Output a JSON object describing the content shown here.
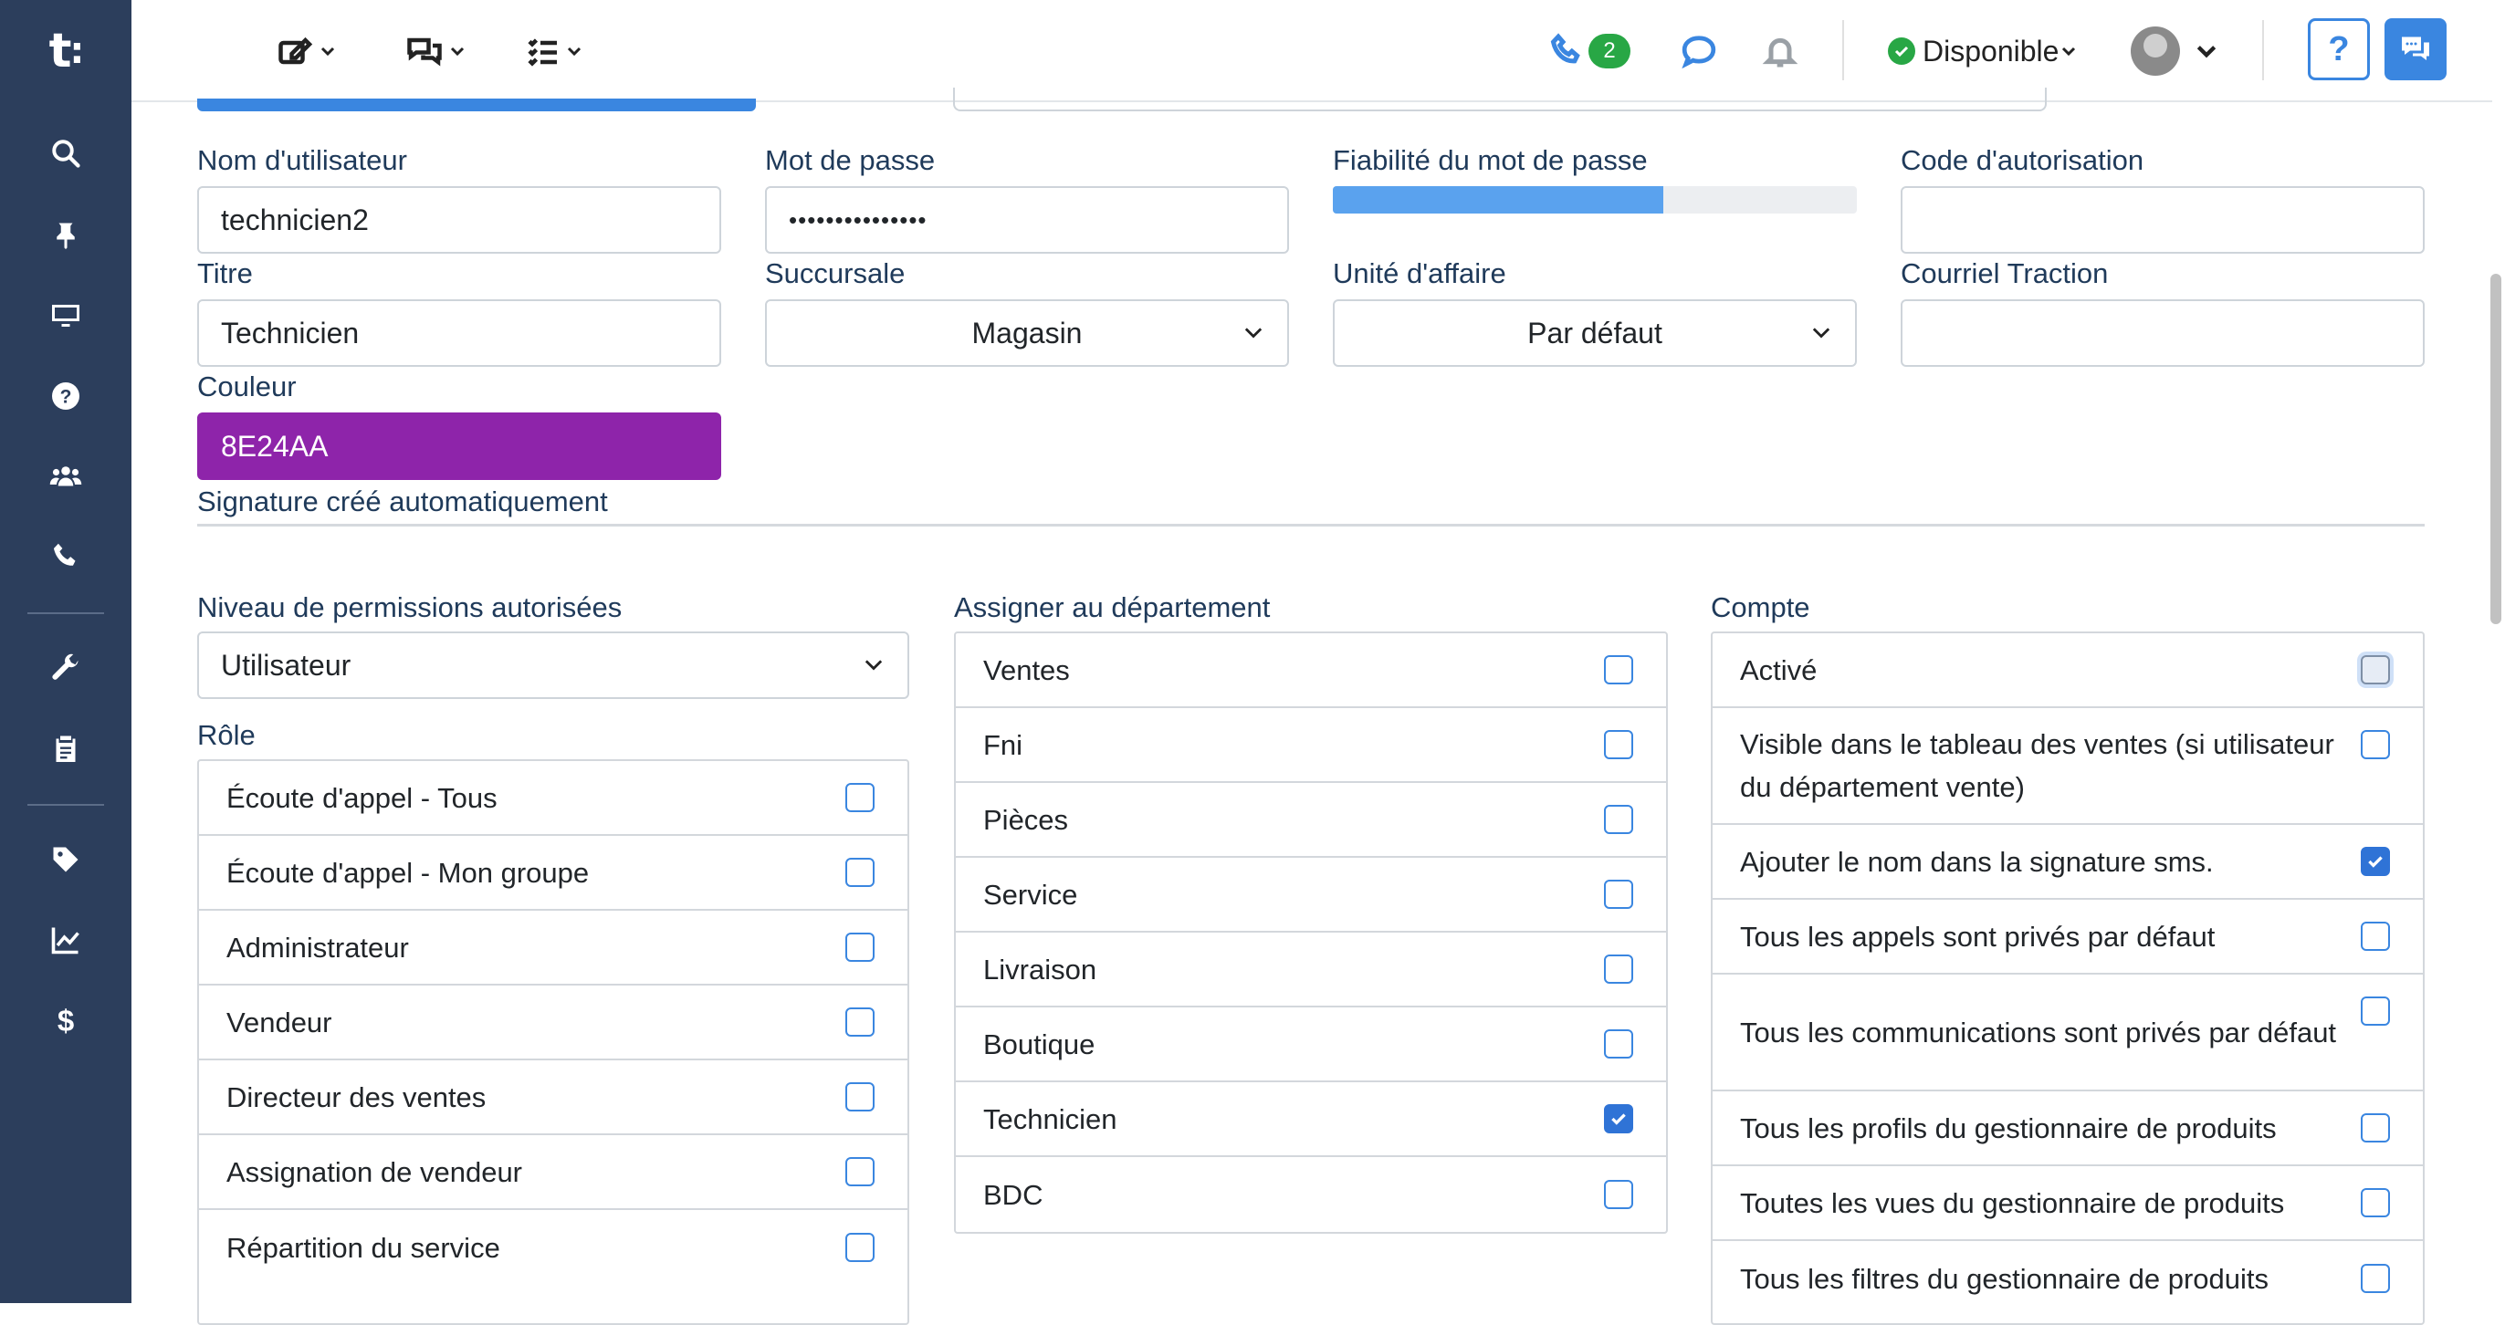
{
  "app": {
    "logo_text": "t",
    "logo_dot": ":"
  },
  "sidebar": {
    "icons": [
      "search-icon",
      "pin-icon",
      "monitor-icon",
      "help-circle-icon",
      "users-icon",
      "phone-icon",
      "wrench-icon",
      "clipboard-icon",
      "tag-icon",
      "chart-line-icon",
      "dollar-icon"
    ]
  },
  "topbar": {
    "call_badge": "2",
    "status_label": "Disponible",
    "help_label": "?"
  },
  "form": {
    "username_label": "Nom d'utilisateur",
    "username_value": "technicien2",
    "password_label": "Mot de passe",
    "password_value": "•••••••••••••••",
    "strength_label": "Fiabilité du mot de passe",
    "strength_fraction": 0.63,
    "auth_code_label": "Code d'autorisation",
    "auth_code_value": "",
    "title_label": "Titre",
    "title_value": "Technicien",
    "branch_label": "Succursale",
    "branch_value": "Magasin",
    "business_unit_label": "Unité d'affaire",
    "business_unit_value": "Par défaut",
    "traction_email_label": "Courriel Traction",
    "traction_email_value": "",
    "color_label": "Couleur",
    "color_value": "8E24AA",
    "signature_label": "Signature créé automatiquement"
  },
  "permissions": {
    "level_label": "Niveau de permissions autorisées",
    "level_value": "Utilisateur",
    "role_label": "Rôle",
    "roles": [
      {
        "label": "Écoute d'appel - Tous",
        "checked": false
      },
      {
        "label": "Écoute d'appel - Mon groupe",
        "checked": false
      },
      {
        "label": "Administrateur",
        "checked": false
      },
      {
        "label": "Vendeur",
        "checked": false
      },
      {
        "label": "Directeur des ventes",
        "checked": false
      },
      {
        "label": "Assignation de vendeur",
        "checked": false
      },
      {
        "label": "Répartition du service",
        "checked": false
      }
    ]
  },
  "departments": {
    "label": "Assigner au département",
    "items": [
      {
        "label": "Ventes",
        "checked": false
      },
      {
        "label": "Fni",
        "checked": false
      },
      {
        "label": "Pièces",
        "checked": false
      },
      {
        "label": "Service",
        "checked": false
      },
      {
        "label": "Livraison",
        "checked": false
      },
      {
        "label": "Boutique",
        "checked": false
      },
      {
        "label": "Technicien",
        "checked": true
      },
      {
        "label": "BDC",
        "checked": false
      }
    ]
  },
  "account": {
    "label": "Compte",
    "items": [
      {
        "label": "Activé",
        "checked": false,
        "focus": true
      },
      {
        "label": "Visible dans le tableau des ventes (si utilisateur du département vente)",
        "checked": false
      },
      {
        "label": "Ajouter le nom dans la signature sms.",
        "checked": true
      },
      {
        "label": "Tous les appels sont privés par défaut",
        "checked": false
      },
      {
        "label": "Tous les communications sont privés par défaut",
        "checked": false
      },
      {
        "label": "Tous les profils du gestionnaire de produits",
        "checked": false
      },
      {
        "label": "Toutes les vues du gestionnaire de produits",
        "checked": false
      },
      {
        "label": "Tous les filtres du gestionnaire de produits",
        "checked": false
      }
    ]
  },
  "colors": {
    "accent": "#3a86e0",
    "sidebar": "#2c3e5c",
    "user_color": "#8e24aa",
    "success": "#28a745"
  }
}
